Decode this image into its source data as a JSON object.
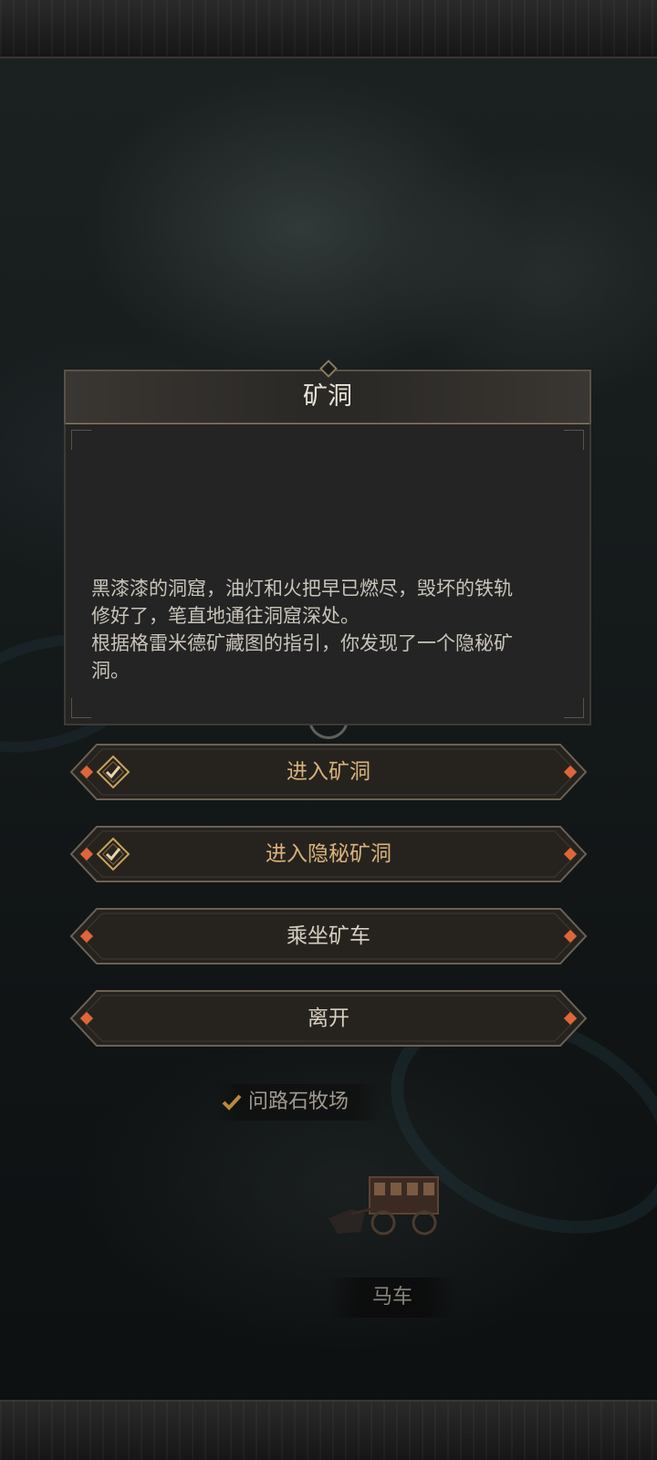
{
  "dialog": {
    "title": "矿洞",
    "description": "黑漆漆的洞窟，油灯和火把早已燃尽，毁坏的铁轨\n修好了，笔直地通往洞窟深处。\n根据格雷米德矿藏图的指引，你发现了一个隐秘矿\n洞。"
  },
  "options": [
    {
      "label": "进入矿洞",
      "icon": "check-emblem-icon",
      "highlighted": true
    },
    {
      "label": "进入隐秘矿洞",
      "icon": "check-emblem-icon",
      "highlighted": true
    },
    {
      "label": "乘坐矿车",
      "highlighted": false
    },
    {
      "label": "离开",
      "highlighted": false
    }
  ],
  "map": {
    "route_label": "问路石牧场",
    "route_icon": "checkmark-icon",
    "wagon_label": "马车"
  },
  "colors": {
    "gold_text": "#d9b27a",
    "gem": "#e0653a",
    "frame": "#6b6154"
  }
}
